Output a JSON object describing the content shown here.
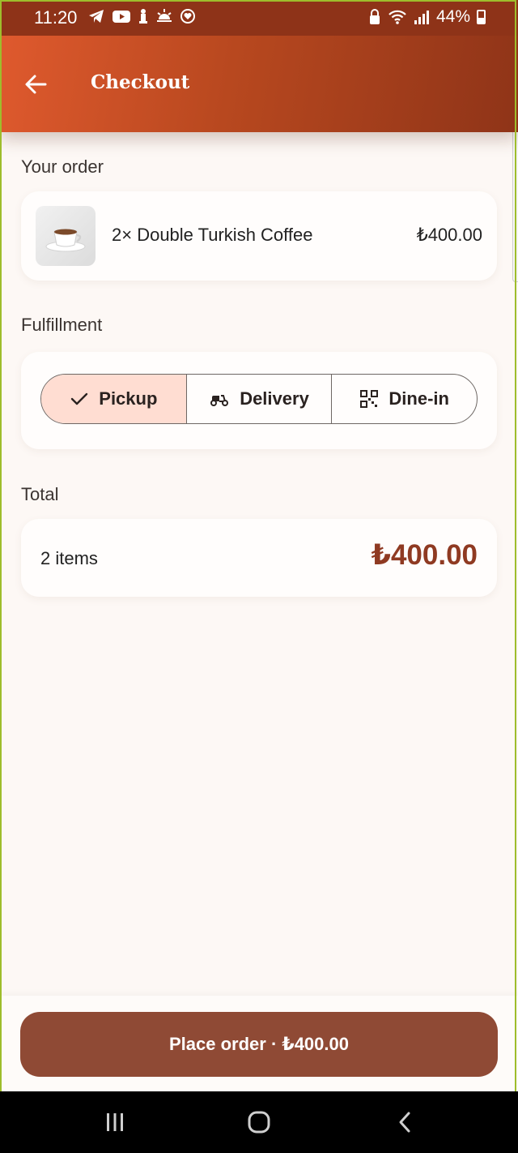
{
  "status_bar": {
    "time": "11:20",
    "battery": "44%",
    "left_icons": [
      "telegram-icon",
      "youtube-icon",
      "chess-icon",
      "weather-icon",
      "heart-icon"
    ],
    "right_icons": [
      "lock-icon",
      "wifi-icon",
      "signal-icon",
      "battery-icon"
    ]
  },
  "header": {
    "title": "Checkout",
    "back_icon": "arrow-left-icon"
  },
  "order": {
    "label": "Your order",
    "items": [
      {
        "name": "2× Double Turkish Coffee",
        "price": "₺400.00",
        "image": "coffee-cup"
      }
    ]
  },
  "fulfillment": {
    "label": "Fulfillment",
    "options": [
      {
        "label": "Pickup",
        "icon": "check-icon",
        "selected": true
      },
      {
        "label": "Delivery",
        "icon": "scooter-icon",
        "selected": false
      },
      {
        "label": "Dine-in",
        "icon": "qr-code-icon",
        "selected": false
      }
    ]
  },
  "total": {
    "label": "Total",
    "items_count": "2 items",
    "amount": "₺400.00"
  },
  "actions": {
    "place_order": "Place order · ₺400.00"
  },
  "colors": {
    "header_start": "#e05a2e",
    "header_end": "#8f3418",
    "accent": "#8f4a35",
    "selected_bg": "#ffddd2",
    "total_amount": "#8f3a22"
  }
}
